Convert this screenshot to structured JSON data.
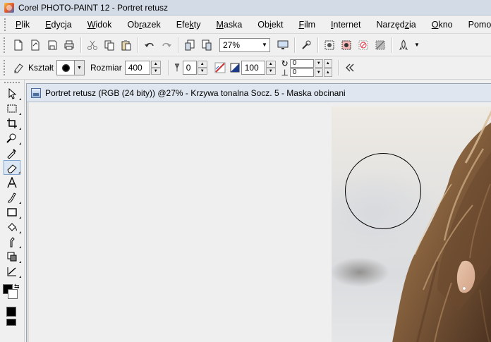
{
  "window": {
    "title": "Corel PHOTO-PAINT 12 - Portret retusz"
  },
  "menu": [
    {
      "label": "Plik"
    },
    {
      "label": "Edycja"
    },
    {
      "label": "Widok"
    },
    {
      "label": "Obrazek"
    },
    {
      "label": "Efekty"
    },
    {
      "label": "Maska"
    },
    {
      "label": "Obiekt"
    },
    {
      "label": "Film"
    },
    {
      "label": "Internet"
    },
    {
      "label": "Narzędzia"
    },
    {
      "label": "Okno"
    },
    {
      "label": "Pomoc"
    }
  ],
  "toolbar": {
    "zoom": "27%"
  },
  "property_bar": {
    "shape_label": "Kształt",
    "size_label": "Rozmiar",
    "size_value": "400",
    "nib_value": "0",
    "transparency_value": "100",
    "rotate_value": "0",
    "flatten_value": "0"
  },
  "document": {
    "title": "Portret retusz (RGB (24 bity)) @27% - Krzywa tonalna Socz. 5 - Maska obcinani"
  },
  "colors": {
    "foreground": "#000000",
    "background": "#ffffff",
    "fill": "#000000"
  }
}
